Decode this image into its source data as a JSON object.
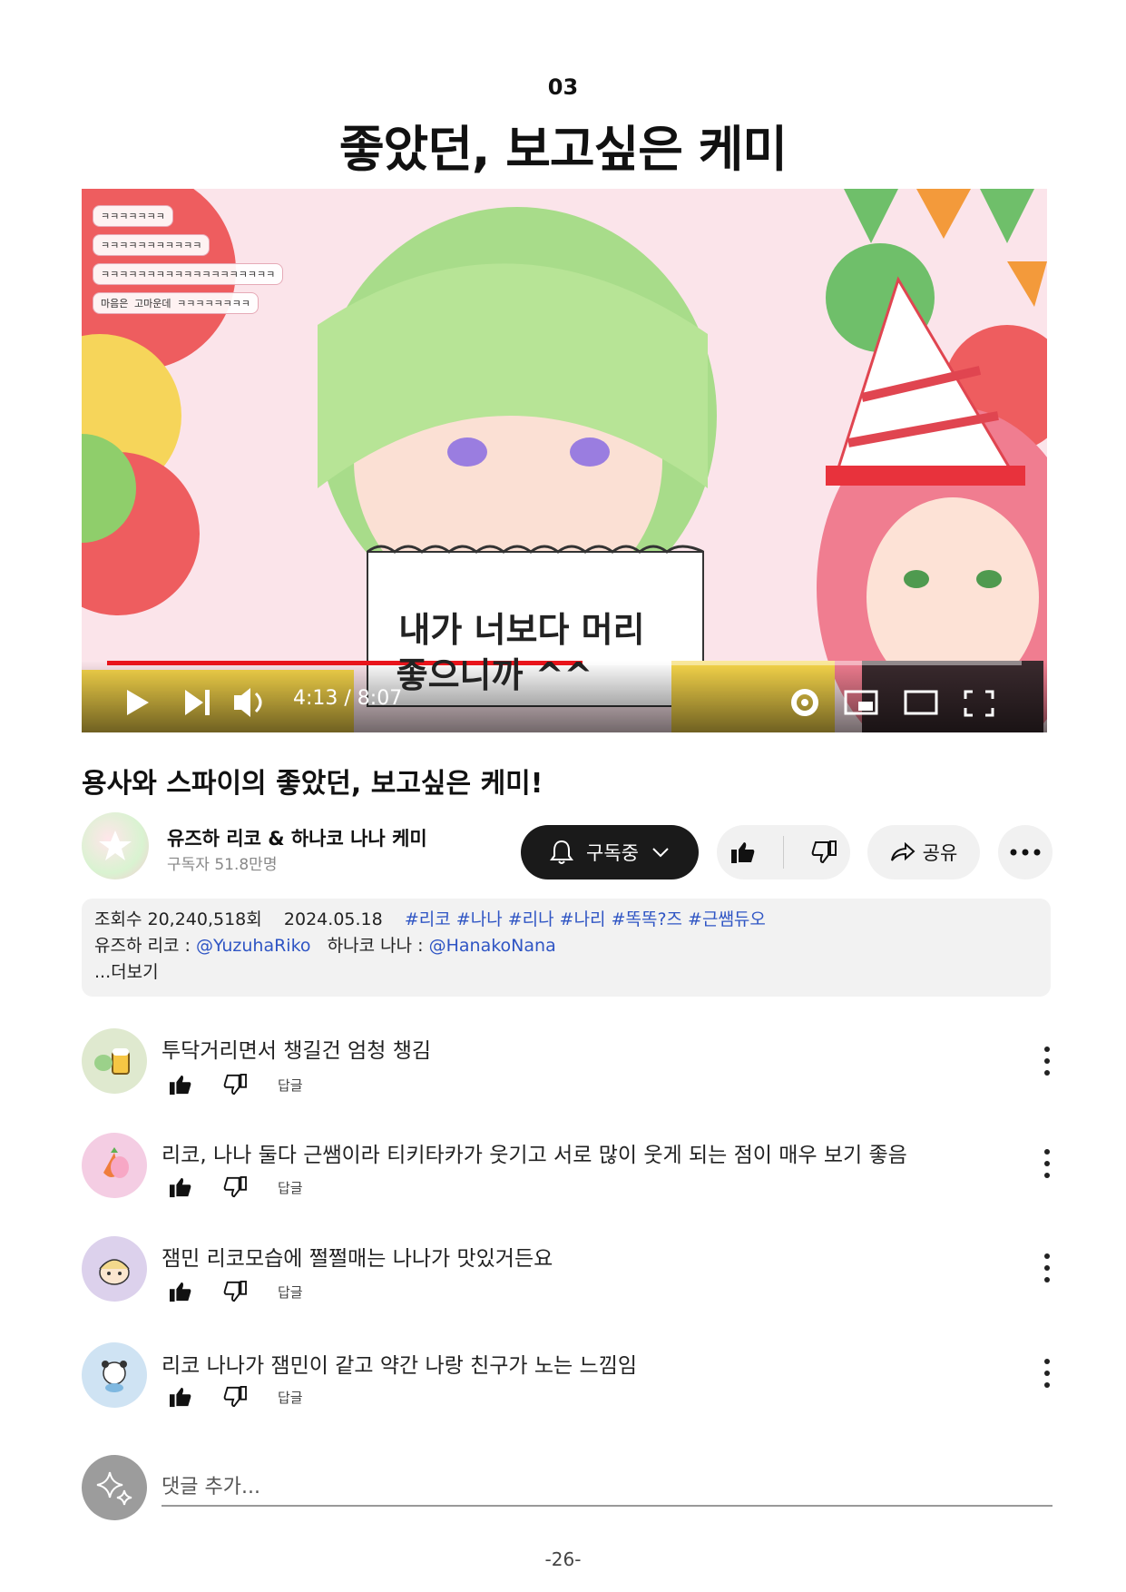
{
  "section": {
    "number": "03",
    "title": "좋았던, 보고싶은 케미"
  },
  "video": {
    "progress": 0.52,
    "time": "4:13 / 8:07",
    "sign_line1": "내가 너보다 머리",
    "sign_line2": "좋으니까 ^^",
    "chat_lines": [
      "ㅋㅋㅋㅋㅋㅋㅋ",
      "ㅋㅋㅋㅋㅋㅋㅋㅋㅋㅋㅋ",
      "ㅋㅋㅋㅋㅋㅋㅋㅋㅋㅋㅋㅋㅋㅋㅋㅋㅋㅋㅋ",
      "마음은 고마운데 ㅋㅋㅋㅋㅋㅋㅋㅋ"
    ]
  },
  "video_title": "용사와 스파이의 좋았던, 보고싶은 케미!",
  "channel": {
    "name": "유즈하 리코 & 하나코 나나 케미",
    "subscribers": "구독자 51.8만명",
    "subscribe_label": "구독중",
    "share_label": "공유"
  },
  "description": {
    "views": "조회수 20,240,518회",
    "date": "2024.05.18",
    "hashtags": "#리코 #나나 #리나 #나리 #똑똑?즈 #근쌤듀오",
    "riko_label": "유즈하 리코 :",
    "riko_handle": "@YuzuhaRiko",
    "nana_label": "하나코 나나 :",
    "nana_handle": "@HanakoNana",
    "more": "...더보기"
  },
  "comments": [
    {
      "text": "투닥거리면서 챙길건 엄청 챙김",
      "reply": "답글",
      "avatar_color": "#dfe9cf"
    },
    {
      "text": "리코, 나나 둘다 근쌤이라 티키타카가 웃기고 서로 많이 웃게 되는 점이 매우 보기 좋음",
      "reply": "답글",
      "avatar_color": "#f4cde3"
    },
    {
      "text": "잼민 리코모습에 쩔쩔매는 나나가 맛있거든요",
      "reply": "답글",
      "avatar_color": "#dcd1ec"
    },
    {
      "text": "리코 나나가 잼민이 같고 약간 나랑 친구가 노는 느낌임",
      "reply": "답글",
      "avatar_color": "#cfe3f3"
    }
  ],
  "add_comment_placeholder": "댓글 추가...",
  "page_number": "-26-",
  "colors": {
    "accent_red": "#e8141b",
    "link_blue": "#2f55c4",
    "dark_button": "#1a1a1a"
  },
  "icons": [
    "play-icon",
    "next-icon",
    "volume-icon",
    "settings-gear-icon",
    "miniplayer-icon",
    "theater-icon",
    "fullscreen-icon",
    "bell-icon",
    "chevron-down-icon",
    "thumbs-up-icon",
    "thumbs-down-icon",
    "share-arrow-icon",
    "more-horizontal-icon",
    "kebab-icon",
    "sparkle-icon"
  ]
}
